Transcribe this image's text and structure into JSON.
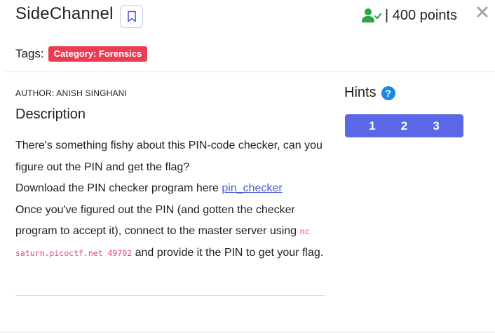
{
  "challenge": {
    "title": "SideChannel",
    "points_label": "| 400 points",
    "tags_label": "Tags:",
    "tags": [
      "Category: Forensics"
    ],
    "author": "AUTHOR: ANISH SINGHANI",
    "description_heading": "Description",
    "description": {
      "p1": "There's something fishy about this PIN-code checker, can you figure out the PIN and get the flag?",
      "p2_prefix": "Download the PIN checker program here ",
      "p2_link": "pin_checker",
      "p3_prefix": "Once you've figured out the PIN (and gotten the checker program to accept it), connect to the master server using ",
      "p3_code": "nc saturn.picoctf.net 49702",
      "p3_suffix": " and provide it the PIN to get your flag."
    }
  },
  "hints": {
    "label": "Hints",
    "help_symbol": "?",
    "buttons": [
      "1",
      "2",
      "3"
    ]
  },
  "colors": {
    "accent": "#5a68e8",
    "tag_bg": "#ea3c53",
    "solved_icon": "#28a745",
    "help_icon": "#1e88e5",
    "code_text": "#e83e8c",
    "link": "#4b59d6"
  },
  "icons": {
    "bookmark": "bookmark-icon",
    "solved": "user-check-icon",
    "close": "close-icon",
    "help": "question-circle-icon"
  }
}
